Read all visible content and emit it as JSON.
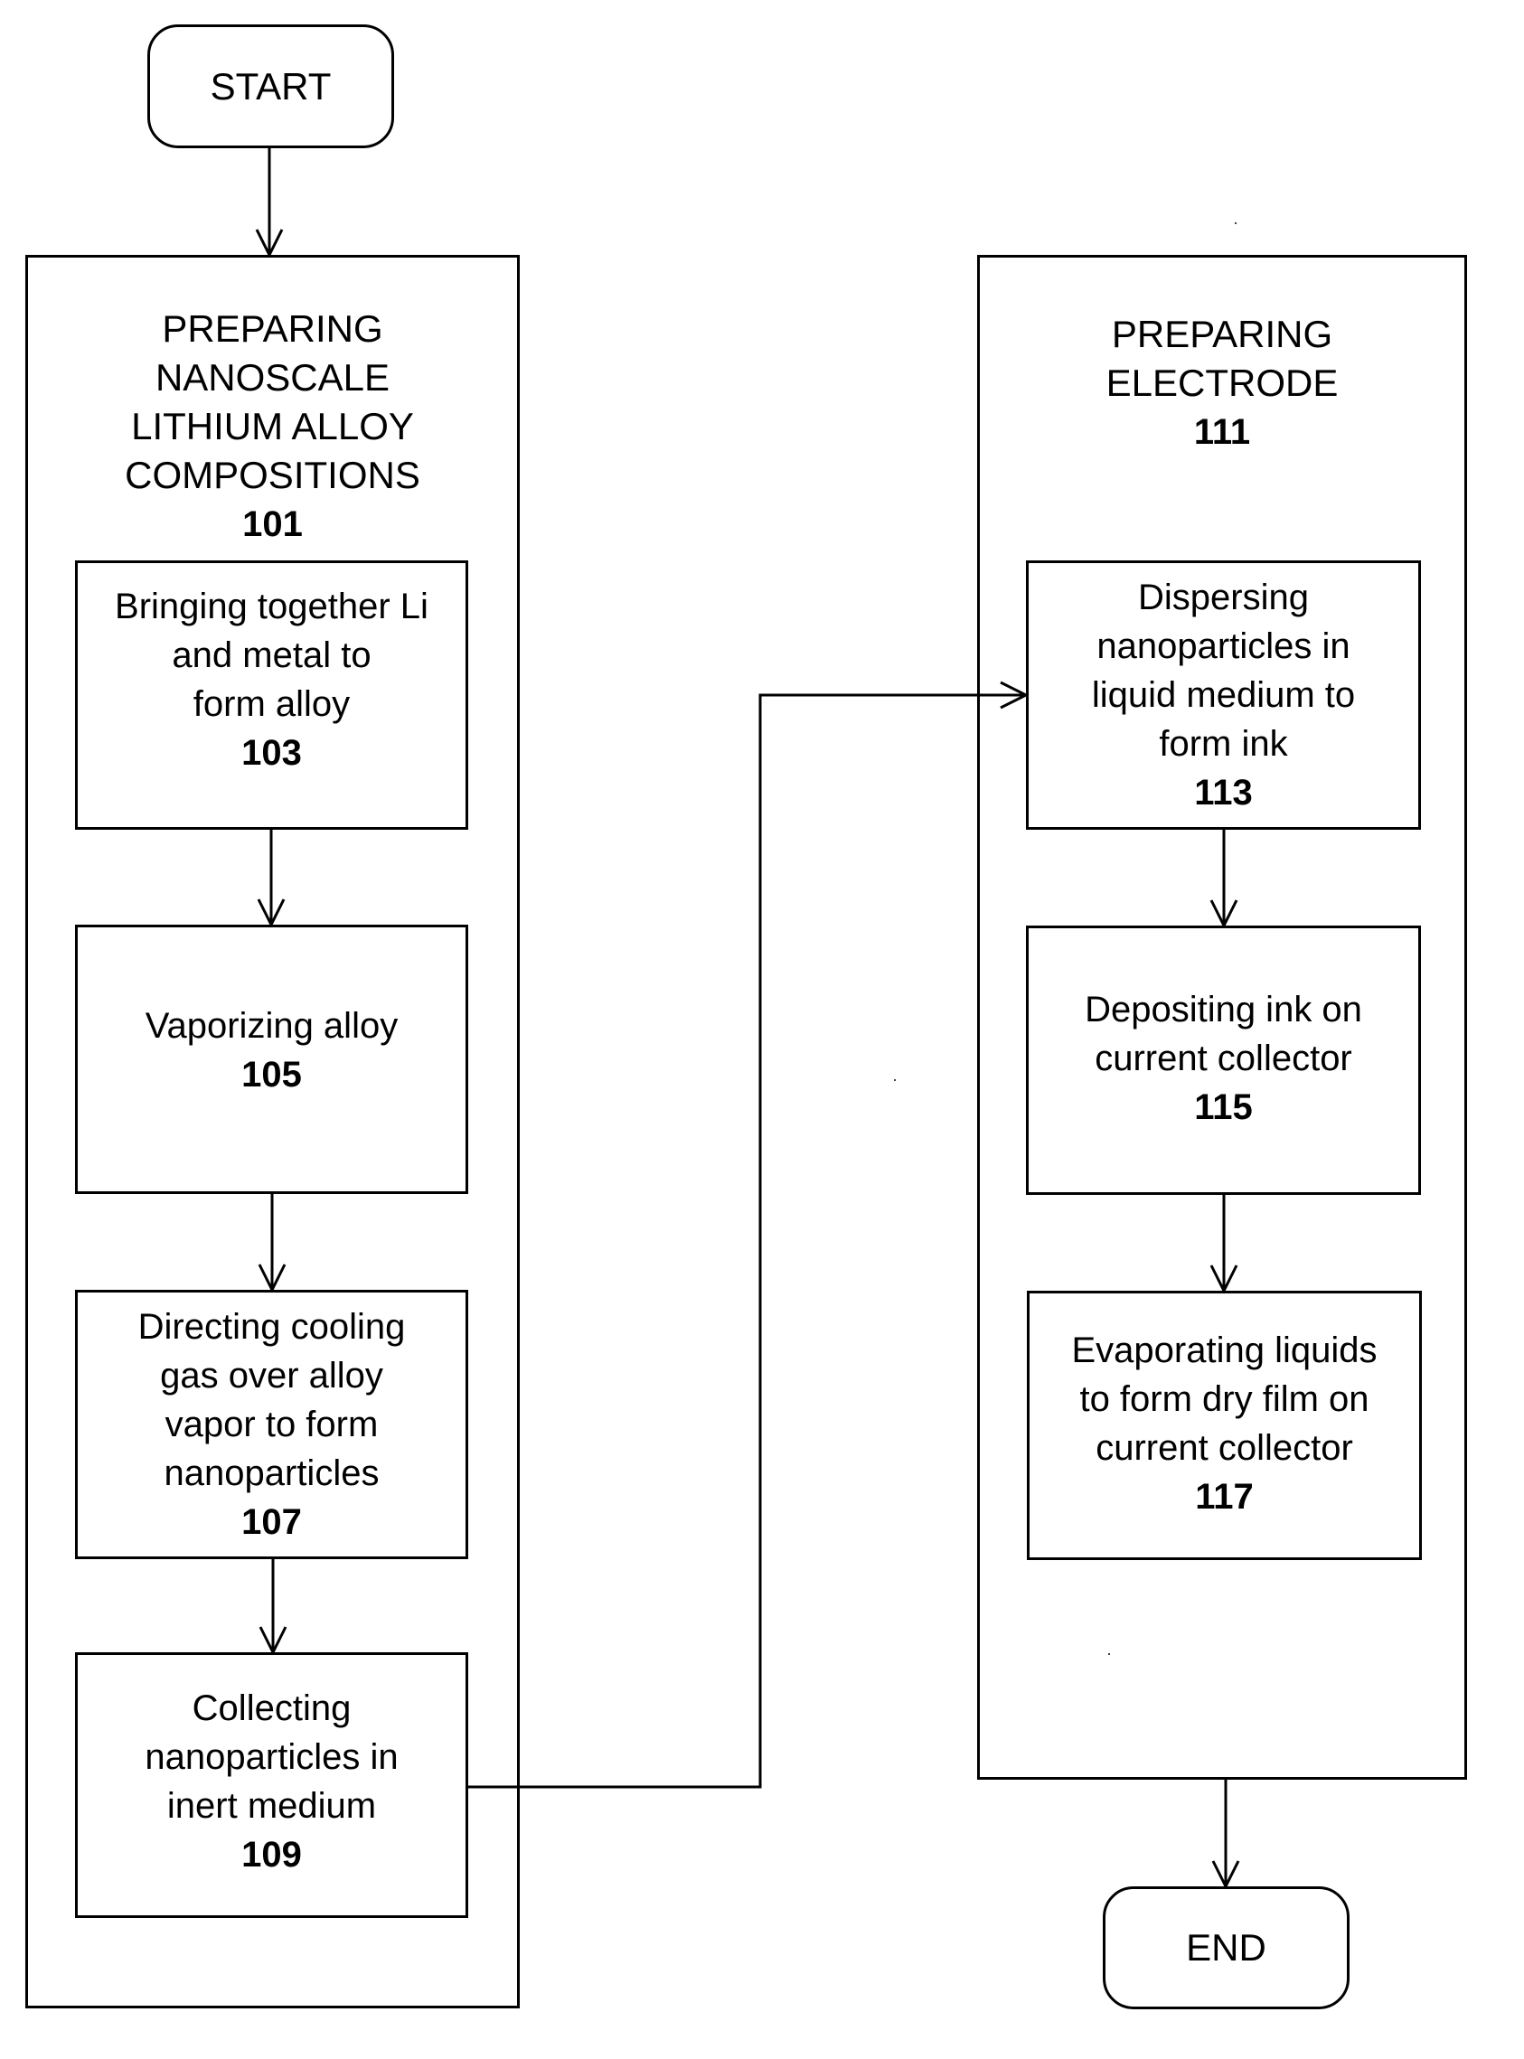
{
  "diagram": {
    "type": "flowchart",
    "start": {
      "label": "START"
    },
    "end": {
      "label": "END"
    },
    "groups": [
      {
        "id": "101",
        "title": "PREPARING\nNANOSCALE\nLITHIUM ALLOY\nCOMPOSITIONS",
        "ref": "101",
        "steps": [
          {
            "id": "103",
            "label": "Bringing together Li\nand metal to\nform alloy",
            "ref": "103"
          },
          {
            "id": "105",
            "label": "Vaporizing alloy",
            "ref": "105"
          },
          {
            "id": "107",
            "label": "Directing cooling\ngas over alloy\nvapor to form\nnanoparticles",
            "ref": "107"
          },
          {
            "id": "109",
            "label": "Collecting\nnanoparticles in\ninert medium",
            "ref": "109"
          }
        ]
      },
      {
        "id": "111",
        "title": "PREPARING\nELECTRODE",
        "ref": "111",
        "steps": [
          {
            "id": "113",
            "label": "Dispersing\nnanoparticles in\nliquid medium to\nform ink",
            "ref": "113"
          },
          {
            "id": "115",
            "label": "Depositing ink on\ncurrent collector",
            "ref": "115"
          },
          {
            "id": "117",
            "label": "Evaporating liquids\nto form dry film on\ncurrent collector",
            "ref": "117"
          }
        ]
      }
    ],
    "edges": [
      {
        "from": "START",
        "to": "101"
      },
      {
        "from": "103",
        "to": "105"
      },
      {
        "from": "105",
        "to": "107"
      },
      {
        "from": "107",
        "to": "109"
      },
      {
        "from": "109",
        "to": "113"
      },
      {
        "from": "113",
        "to": "115"
      },
      {
        "from": "115",
        "to": "117"
      },
      {
        "from": "111",
        "to": "END"
      }
    ]
  }
}
